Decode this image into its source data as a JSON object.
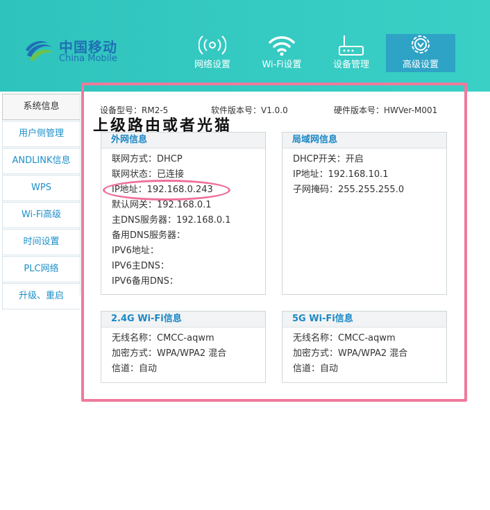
{
  "brand": {
    "name_cn": "中国移动",
    "name_en": "China Mobile"
  },
  "nav": [
    {
      "label": "网络设置",
      "icon": "signal-icon"
    },
    {
      "label": "Wi-Fi设置",
      "icon": "wifi-icon"
    },
    {
      "label": "设备管理",
      "icon": "router-icon"
    },
    {
      "label": "高级设置",
      "icon": "gear-icon",
      "active": true
    }
  ],
  "sidebar": {
    "items": [
      {
        "label": "系统信息",
        "active": true
      },
      {
        "label": "用户侧管理"
      },
      {
        "label": "ANDLINK信息"
      },
      {
        "label": "WPS"
      },
      {
        "label": "Wi-Fi高级"
      },
      {
        "label": "时间设置"
      },
      {
        "label": "PLC网络"
      },
      {
        "label": "升级、重启"
      }
    ]
  },
  "versions": {
    "model": "设备型号：RM2-5",
    "software": "软件版本号：V1.0.0",
    "hardware": "硬件版本号：HWVer-M001"
  },
  "annotation": "上级路由或者光猫",
  "wan": {
    "title": "外网信息",
    "rows": [
      "联网方式：DHCP",
      "联网状态：已连接",
      "IP地址：192.168.0.243",
      "默认网关：192.168.0.1",
      "主DNS服务器：192.168.0.1",
      "备用DNS服务器：",
      "IPV6地址：",
      "IPV6主DNS：",
      "IPV6备用DNS："
    ]
  },
  "lan": {
    "title": "局域网信息",
    "rows": [
      "DHCP开关：开启",
      "IP地址：192.168.10.1",
      "子网掩码：255.255.255.0"
    ]
  },
  "wifi24": {
    "title": "2.4G Wi-Fi信息",
    "rows": [
      "无线名称：CMCC-aqwm",
      "加密方式：WPA/WPA2 混合",
      "信道：自动"
    ]
  },
  "wifi5": {
    "title": "5G Wi-Fi信息",
    "rows": [
      "无线名称：CMCC-aqwm",
      "加密方式：WPA/WPA2 混合",
      "信道：自动"
    ]
  },
  "colors": {
    "header": "#33c8c0",
    "active_nav": "#2ea3c6",
    "link": "#1d8fc9",
    "highlight": "#ee7a9c"
  }
}
